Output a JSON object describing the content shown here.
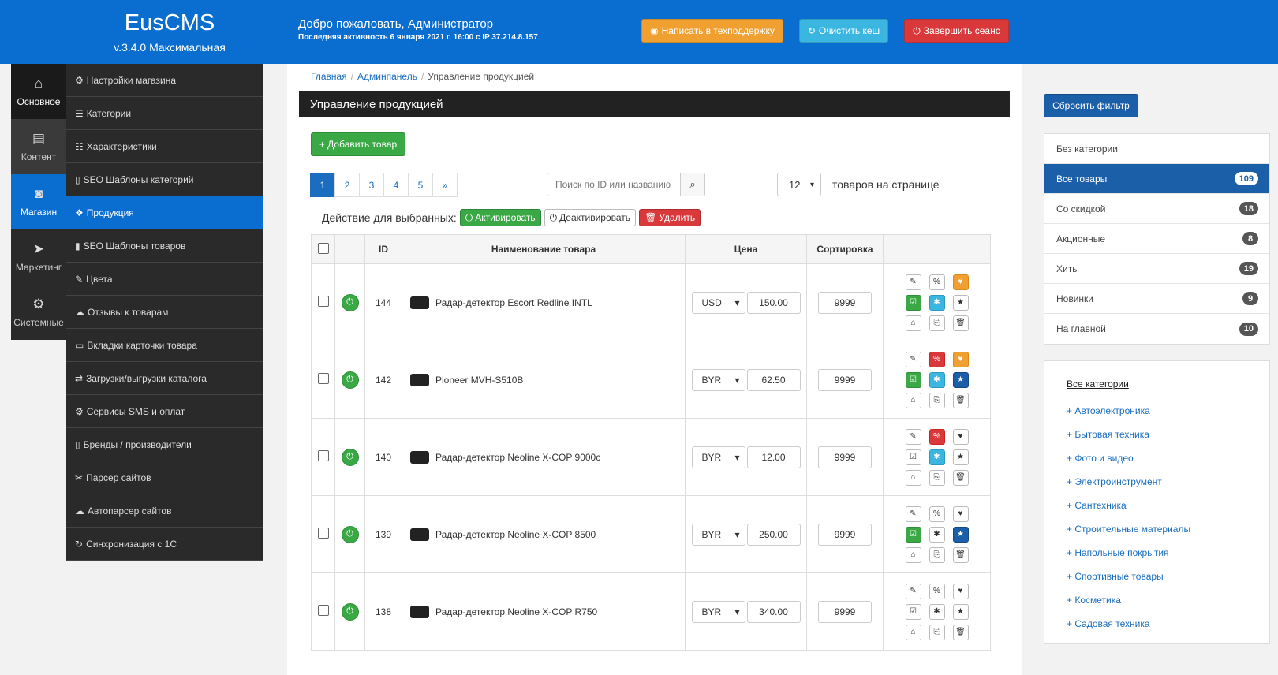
{
  "header": {
    "brand": "EusCMS",
    "version": "v.3.4.0 Максимальная",
    "welcome": "Добро пожаловать, Администратор",
    "last_activity": "Последняя активность 6 января 2021 г. 16:00 с IP 37.214.8.157",
    "btn_support": "Написать в техподдержку",
    "btn_cache": "Очистить кеш",
    "btn_logout": "Завершить сеанс"
  },
  "iconnav": [
    {
      "label": "Основное",
      "icon": "home-icon"
    },
    {
      "label": "Контент",
      "icon": "file-icon"
    },
    {
      "label": "Магазин",
      "icon": "shopping-bag-icon"
    },
    {
      "label": "Маркетинг",
      "icon": "paper-plane-icon"
    },
    {
      "label": "Системные",
      "icon": "gear-icon"
    }
  ],
  "submenu": [
    {
      "label": "Настройки магазина",
      "icon": "⚙"
    },
    {
      "label": "Категории",
      "icon": "☰"
    },
    {
      "label": "Характеристики",
      "icon": "☷"
    },
    {
      "label": "SEO Шаблоны категорий",
      "icon": "▯"
    },
    {
      "label": "Продукция",
      "icon": "❖"
    },
    {
      "label": "SEO Шаблоны товаров",
      "icon": "▮"
    },
    {
      "label": "Цвета",
      "icon": "✎"
    },
    {
      "label": "Отзывы к товарам",
      "icon": "☁"
    },
    {
      "label": "Вкладки карточки товара",
      "icon": "▭"
    },
    {
      "label": "Загрузки/выгрузки каталога",
      "icon": "⇄"
    },
    {
      "label": "Сервисы SMS и оплат",
      "icon": "⚙"
    },
    {
      "label": "Бренды / производители",
      "icon": "▯"
    },
    {
      "label": "Парсер сайтов",
      "icon": "✂"
    },
    {
      "label": "Автопарсер сайтов",
      "icon": "☁"
    },
    {
      "label": "Синхронизация с 1С",
      "icon": "↻"
    }
  ],
  "breadcrumb": {
    "home": "Главная",
    "admin": "Админпанель",
    "current": "Управление продукцией"
  },
  "page_title": "Управление продукцией",
  "add_button": "+ Добавить товар",
  "pager": [
    "1",
    "2",
    "3",
    "4",
    "5",
    "»"
  ],
  "search": {
    "placeholder": "Поиск по ID или названию",
    "value": ""
  },
  "perpage": {
    "value": "12",
    "label": "товаров на странице"
  },
  "bulk": {
    "label": "Действие для выбранных:",
    "activate": "Активировать",
    "deactivate": "Деактивировать",
    "delete": "Удалить"
  },
  "table": {
    "headers": {
      "id": "ID",
      "name": "Наименование товара",
      "price": "Цена",
      "sort": "Сортировка"
    },
    "rows": [
      {
        "id": "144",
        "name": "Радар-детектор Escort Redline INTL",
        "currency": "USD",
        "price": "150.00",
        "sort": "9999",
        "icons": [
          "",
          "",
          "orange",
          "green",
          "cyan",
          "",
          "",
          "",
          ""
        ]
      },
      {
        "id": "142",
        "name": "Pioneer MVH-S510B",
        "currency": "BYR",
        "price": "62.50",
        "sort": "9999",
        "icons": [
          "",
          "red",
          "orange",
          "green",
          "cyan",
          "blue",
          "",
          "",
          ""
        ]
      },
      {
        "id": "140",
        "name": "Радар-детектор Neoline X-COP 9000c",
        "currency": "BYR",
        "price": "12.00",
        "sort": "9999",
        "icons": [
          "",
          "red",
          "",
          "",
          "cyan",
          "",
          "",
          "",
          ""
        ]
      },
      {
        "id": "139",
        "name": "Радар-детектор Neoline X-COP 8500",
        "currency": "BYR",
        "price": "250.00",
        "sort": "9999",
        "icons": [
          "",
          "",
          "",
          "green",
          "",
          "blue",
          "",
          "",
          ""
        ]
      },
      {
        "id": "138",
        "name": "Радар-детектор Neoline X-COP R750",
        "currency": "BYR",
        "price": "340.00",
        "sort": "9999",
        "icons": [
          "",
          "",
          "",
          "",
          "",
          "",
          "",
          "",
          ""
        ]
      }
    ]
  },
  "right": {
    "reset": "Сбросить фильтр",
    "filters": [
      {
        "label": "Без категории",
        "count": ""
      },
      {
        "label": "Все товары",
        "count": "109"
      },
      {
        "label": "Со скидкой",
        "count": "18"
      },
      {
        "label": "Акционные",
        "count": "8"
      },
      {
        "label": "Хиты",
        "count": "19"
      },
      {
        "label": "Новинки",
        "count": "9"
      },
      {
        "label": "На главной",
        "count": "10"
      }
    ],
    "all_categories": "Все категории",
    "categories": [
      "+ Автоэлектроника",
      "+ Бытовая техника",
      "+ Фото и видео",
      "+ Электроинструмент",
      "+ Сантехника",
      "+ Строительные материалы",
      "+ Напольные покрытия",
      "+ Спортивные товары",
      "+ Косметика",
      "+ Садовая техника"
    ]
  }
}
